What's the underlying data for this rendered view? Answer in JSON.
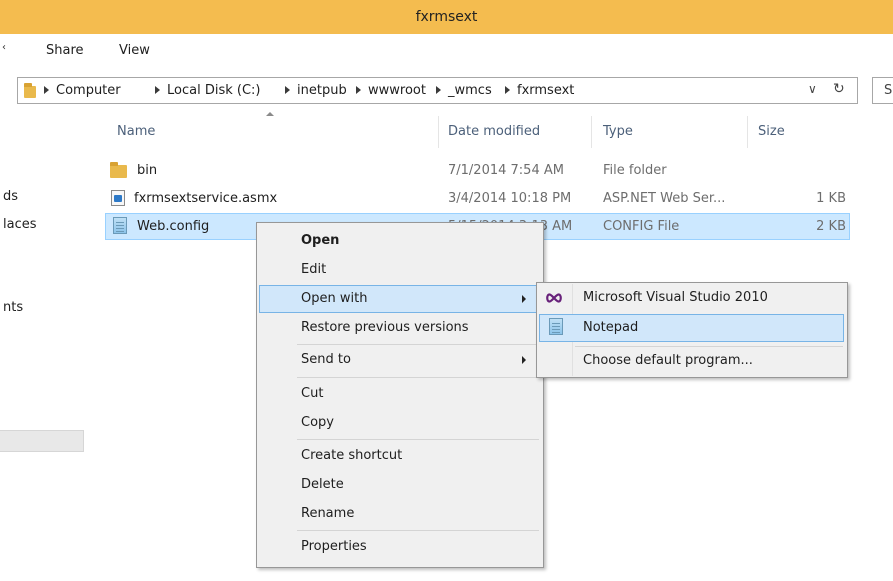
{
  "window": {
    "title": "fxrmsext"
  },
  "ribbon": {
    "tabs": [
      "Share",
      "View"
    ]
  },
  "address": {
    "path": [
      "Computer",
      "Local Disk (C:)",
      "inetpub",
      "wwwroot",
      "_wmcs",
      "fxrmsext"
    ],
    "search_placeholder": "S"
  },
  "nav": {
    "items": [
      "ds",
      "laces",
      "nts"
    ]
  },
  "columns": {
    "name": "Name",
    "date": "Date modified",
    "type": "Type",
    "size": "Size"
  },
  "files": [
    {
      "name": "bin",
      "date": "7/1/2014 7:54 AM",
      "type": "File folder",
      "size": "",
      "icon": "folder-icon"
    },
    {
      "name": "fxrmsextservice.asmx",
      "date": "3/4/2014 10:18 PM",
      "type": "ASP.NET Web Ser...",
      "size": "1 KB",
      "icon": "aspx-file-icon"
    },
    {
      "name": "Web.config",
      "date": "5/15/2014 3:13 AM",
      "type": "CONFIG File",
      "size": "2 KB",
      "icon": "config-file-icon",
      "selected": true
    }
  ],
  "context_menu": {
    "open": "Open",
    "edit": "Edit",
    "open_with": "Open with",
    "restore": "Restore previous versions",
    "send_to": "Send to",
    "cut": "Cut",
    "copy": "Copy",
    "create_shortcut": "Create shortcut",
    "delete": "Delete",
    "rename": "Rename",
    "properties": "Properties"
  },
  "open_with_menu": {
    "items": [
      "Microsoft Visual Studio 2010",
      "Notepad",
      "Choose default program..."
    ],
    "highlighted": "Notepad"
  },
  "colors": {
    "titlebar": "#f4bc4f",
    "selection": "#cce8ff",
    "menu_highlight": "#d1e7fa"
  }
}
